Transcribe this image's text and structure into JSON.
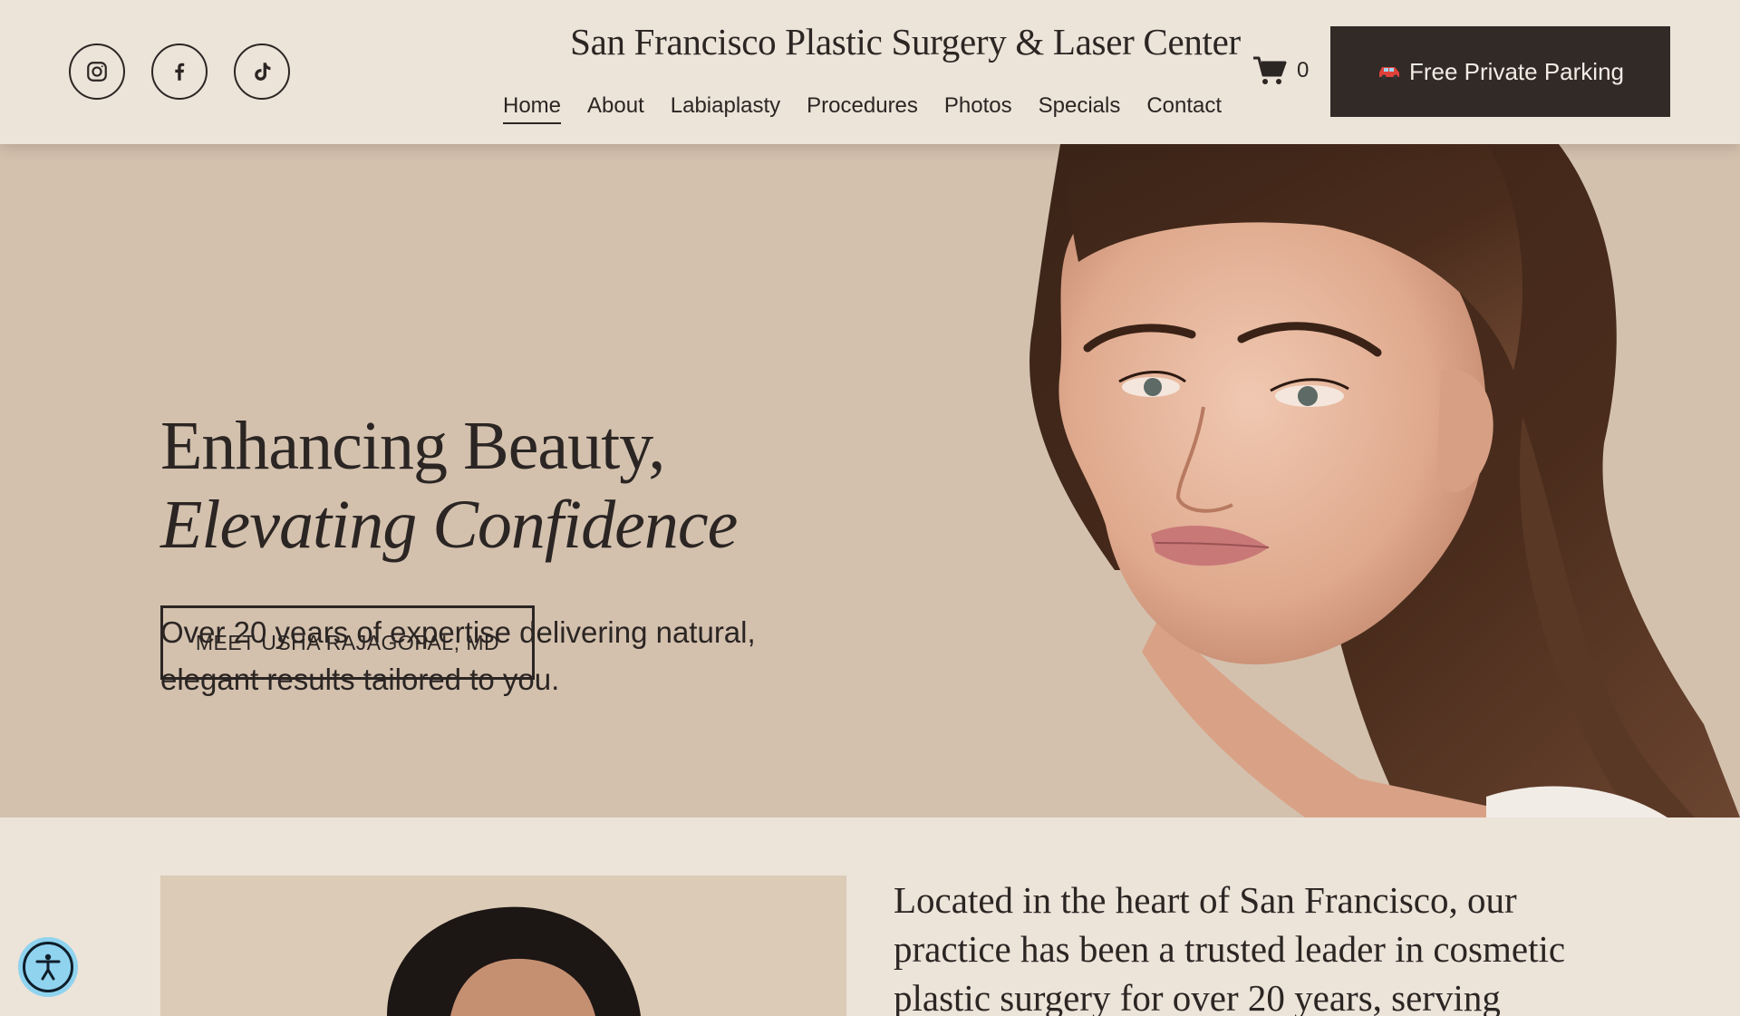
{
  "header": {
    "site_title": "San Francisco Plastic Surgery & Laser Center",
    "socials": [
      {
        "name": "instagram",
        "icon": "instagram-icon"
      },
      {
        "name": "facebook",
        "icon": "facebook-icon"
      },
      {
        "name": "tiktok",
        "icon": "tiktok-icon"
      }
    ],
    "nav": [
      {
        "label": "Home",
        "active": true
      },
      {
        "label": "About"
      },
      {
        "label": "Labiaplasty"
      },
      {
        "label": "Procedures"
      },
      {
        "label": "Photos"
      },
      {
        "label": "Specials"
      },
      {
        "label": "Contact"
      }
    ],
    "cart_count": "0",
    "parking_label": "Free Private Parking",
    "parking_icon": "car-icon"
  },
  "hero": {
    "heading_line1": "Enhancing Beauty,",
    "heading_line2": "Elevating Confidence",
    "subtext": "Over 20 years of expertise delivering natural, elegant results tailored to you.",
    "cta_label": "MEET USHA RAJAGOPAL, MD"
  },
  "intro": {
    "text": "Located in the heart of San Francisco, our practice has been a trusted leader in cosmetic plastic surgery for over 20 years, serving"
  },
  "colors": {
    "header_bg": "#ece3d9",
    "hero_bg": "#d3c1ae",
    "dark": "#2b2523",
    "button_bg": "#312a27",
    "accessibility": "#8fd3ef"
  }
}
